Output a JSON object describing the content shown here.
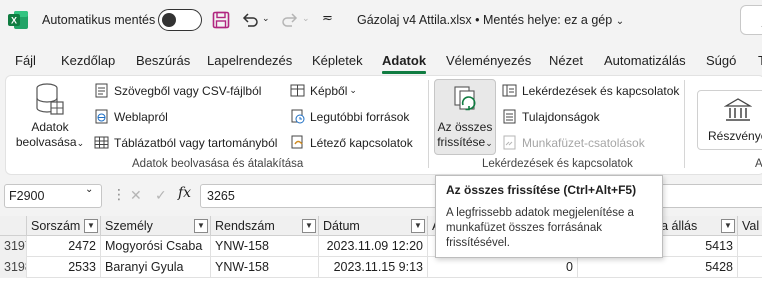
{
  "titlebar": {
    "autosave_label": "Automatikus mentés",
    "document_title": "Gázolaj v4 Attila.xlsx • Mentés helye: ez a gép",
    "accent_color": "#107c41"
  },
  "tabs": [
    {
      "label": "Fájl"
    },
    {
      "label": "Kezdőlap"
    },
    {
      "label": "Beszúrás"
    },
    {
      "label": "Lapelrendezés"
    },
    {
      "label": "Képletek"
    },
    {
      "label": "Adatok",
      "active": true
    },
    {
      "label": "Véleményezés"
    },
    {
      "label": "Nézet"
    },
    {
      "label": "Automatizálás"
    },
    {
      "label": "Súgó"
    }
  ],
  "ribbon": {
    "get_data": {
      "big_button_line1": "Adatok",
      "big_button_line2": "beolvasása",
      "items": [
        "Szövegből vagy CSV-fájlból",
        "Weblapról",
        "Táblázatból vagy tartományból",
        "Képből",
        "Legutóbbi források",
        "Létező kapcsolatok"
      ],
      "group_label": "Adatok beolvasása és átalakítása"
    },
    "queries": {
      "refresh_line1": "Az összes",
      "refresh_line2": "frissítése",
      "items": [
        "Lekérdezések és kapcsolatok",
        "Tulajdonságok",
        "Munkafüzet-csatolások"
      ],
      "group_label": "Lekérdezések és kapcsolatok"
    },
    "data_types": {
      "button_label": "Részvénye"
    }
  },
  "formula_bar": {
    "name_box": "F2900",
    "fx": "fx",
    "value": "3265"
  },
  "grid": {
    "headers": [
      "Sorszám",
      "Személy",
      "Rendszám",
      "Dátum",
      "A",
      "óra állás",
      "Val"
    ],
    "rows": [
      {
        "rownum": "3197",
        "sorszam": "2472",
        "szemely": "Mogyorósi Csaba",
        "rendszam": "YNW-158",
        "datum": "2023.11.09 12:20",
        "col_e": "",
        "ora_allas": "5413"
      },
      {
        "rownum": "3198",
        "sorszam": "2533",
        "szemely": "Baranyi Gyula",
        "rendszam": "YNW-158",
        "datum": "2023.11.15 9:13",
        "col_e": "0",
        "ora_allas": "5428"
      }
    ]
  },
  "tooltip": {
    "title": "Az összes frissítése (Ctrl+Alt+F5)",
    "body": "A legfrissebb adatok megjelenítése a munkafüzet összes forrásának frissítésével."
  }
}
